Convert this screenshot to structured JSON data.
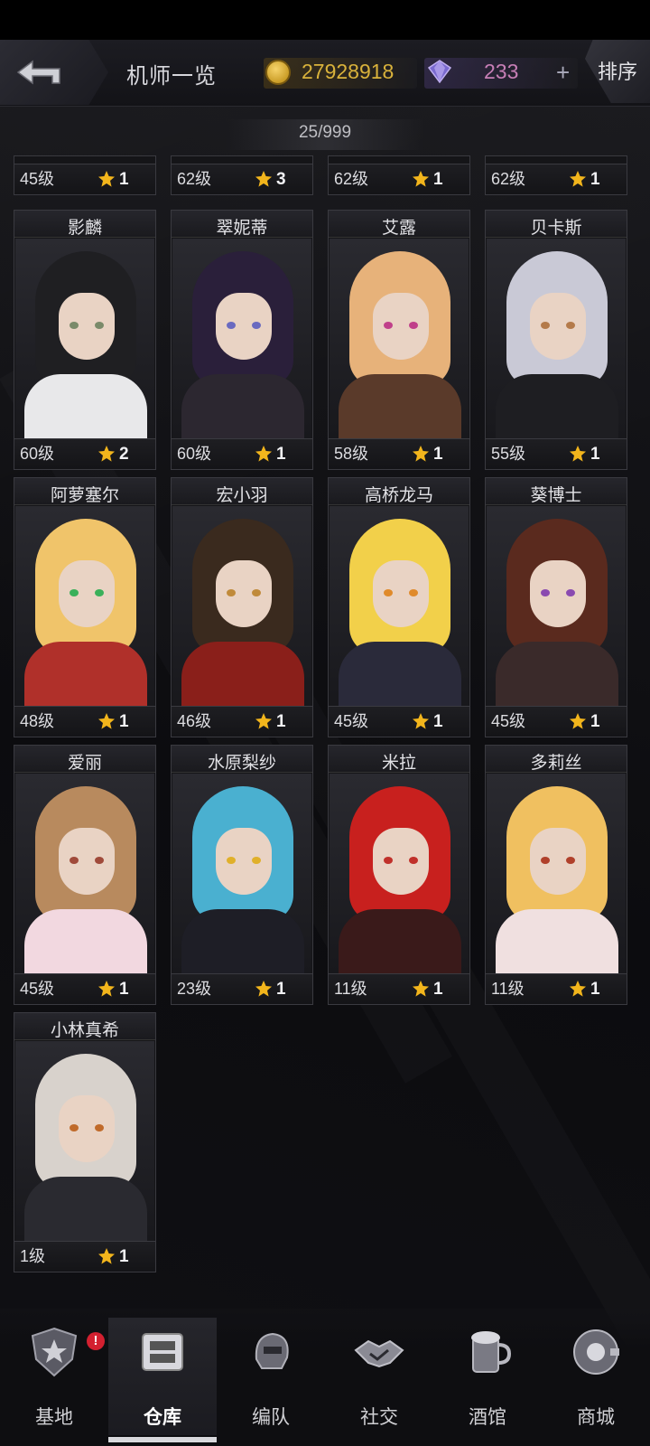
{
  "header": {
    "title": "机师一览",
    "coins": "27928918",
    "gems": "233",
    "plus": "+",
    "sort_label": "排序"
  },
  "roster_count": "25/999",
  "partial_row": [
    {
      "level": "45级",
      "stars": "1"
    },
    {
      "level": "62级",
      "stars": "3"
    },
    {
      "level": "62级",
      "stars": "1"
    },
    {
      "level": "62级",
      "stars": "1"
    }
  ],
  "pilots": [
    {
      "name": "影麟",
      "level": "60级",
      "stars": "2",
      "hair": "#1f1f22",
      "eye": "#7a8a6a",
      "outfit": "#e8e8ea"
    },
    {
      "name": "翠妮蒂",
      "level": "60级",
      "stars": "1",
      "hair": "#2a1f3a",
      "eye": "#6a6ac0",
      "outfit": "#2c2730"
    },
    {
      "name": "艾露",
      "level": "58级",
      "stars": "1",
      "hair": "#e7b27a",
      "eye": "#c0408a",
      "outfit": "#5a3a2a"
    },
    {
      "name": "贝卡斯",
      "level": "55级",
      "stars": "1",
      "hair": "#c9c9d6",
      "eye": "#b47a4a",
      "outfit": "#1e1e22"
    },
    {
      "name": "阿萝塞尔",
      "level": "48级",
      "stars": "1",
      "hair": "#f0c46a",
      "eye": "#3ab05a",
      "outfit": "#b0302a"
    },
    {
      "name": "宏小羽",
      "level": "46级",
      "stars": "1",
      "hair": "#3a2a1e",
      "eye": "#c08a3a",
      "outfit": "#8a1f1a"
    },
    {
      "name": "高桥龙马",
      "level": "45级",
      "stars": "1",
      "hair": "#f2d04a",
      "eye": "#e08a2a",
      "outfit": "#2a2a3a"
    },
    {
      "name": "葵博士",
      "level": "45级",
      "stars": "1",
      "hair": "#5a2a1e",
      "eye": "#8a4ab0",
      "outfit": "#3a2a2a"
    },
    {
      "name": "爱丽",
      "level": "45级",
      "stars": "1",
      "hair": "#b88a5e",
      "eye": "#a04a3a",
      "outfit": "#f2d8e0"
    },
    {
      "name": "水原梨纱",
      "level": "23级",
      "stars": "1",
      "hair": "#4ab0d0",
      "eye": "#e0b02a",
      "outfit": "#1e1e26"
    },
    {
      "name": "米拉",
      "level": "11级",
      "stars": "1",
      "hair": "#c8201e",
      "eye": "#c0302a",
      "outfit": "#3a1a1a"
    },
    {
      "name": "多莉丝",
      "level": "11级",
      "stars": "1",
      "hair": "#f0c060",
      "eye": "#b0402a",
      "outfit": "#f0e0e0"
    },
    {
      "name": "小林真希",
      "level": "1级",
      "stars": "1",
      "hair": "#d8d2cc",
      "eye": "#c06a2a",
      "outfit": "#2a2a30"
    }
  ],
  "nav": [
    {
      "label": "基地",
      "icon": "base-icon",
      "badge": "!"
    },
    {
      "label": "仓库",
      "icon": "warehouse-icon"
    },
    {
      "label": "编队",
      "icon": "squad-icon"
    },
    {
      "label": "社交",
      "icon": "social-icon"
    },
    {
      "label": "酒馆",
      "icon": "tavern-icon"
    },
    {
      "label": "商城",
      "icon": "shop-icon"
    }
  ],
  "colors": {
    "coin": "#d9b23b",
    "gem": "#c77fb6",
    "star": "#f2b51c",
    "badge": "#d32030"
  }
}
